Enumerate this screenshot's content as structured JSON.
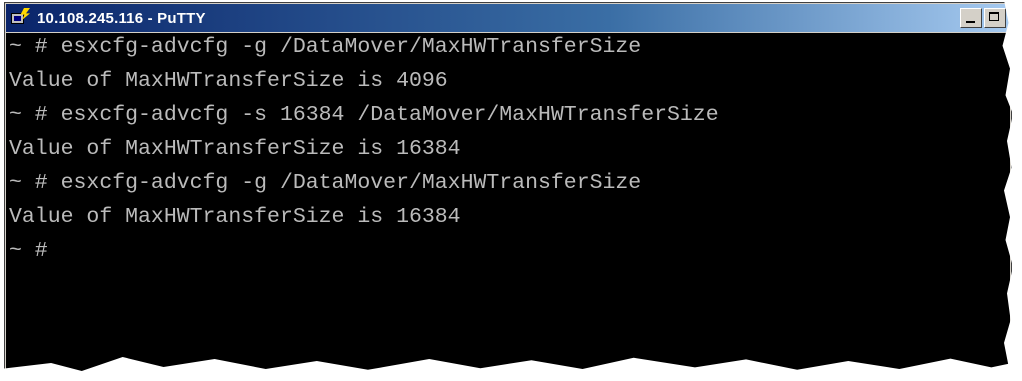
{
  "window": {
    "title": "10.108.245.116 - PuTTY",
    "icon": "putty-icon",
    "controls": [
      "minimize",
      "maximize"
    ]
  },
  "terminal": {
    "lines": [
      "~ # esxcfg-advcfg -g /DataMover/MaxHWTransferSize",
      "Value of MaxHWTransferSize is 4096",
      "~ # esxcfg-advcfg -s 16384 /DataMover/MaxHWTransferSize",
      "Value of MaxHWTransferSize is 16384",
      "~ # esxcfg-advcfg -g /DataMover/MaxHWTransferSize",
      "Value of MaxHWTransferSize is 16384",
      "~ #"
    ]
  },
  "colors": {
    "terminal_background": "#000000",
    "terminal_text": "#bbbbbb",
    "titlebar_start": "#0a246a",
    "titlebar_end": "#a6caf0"
  }
}
